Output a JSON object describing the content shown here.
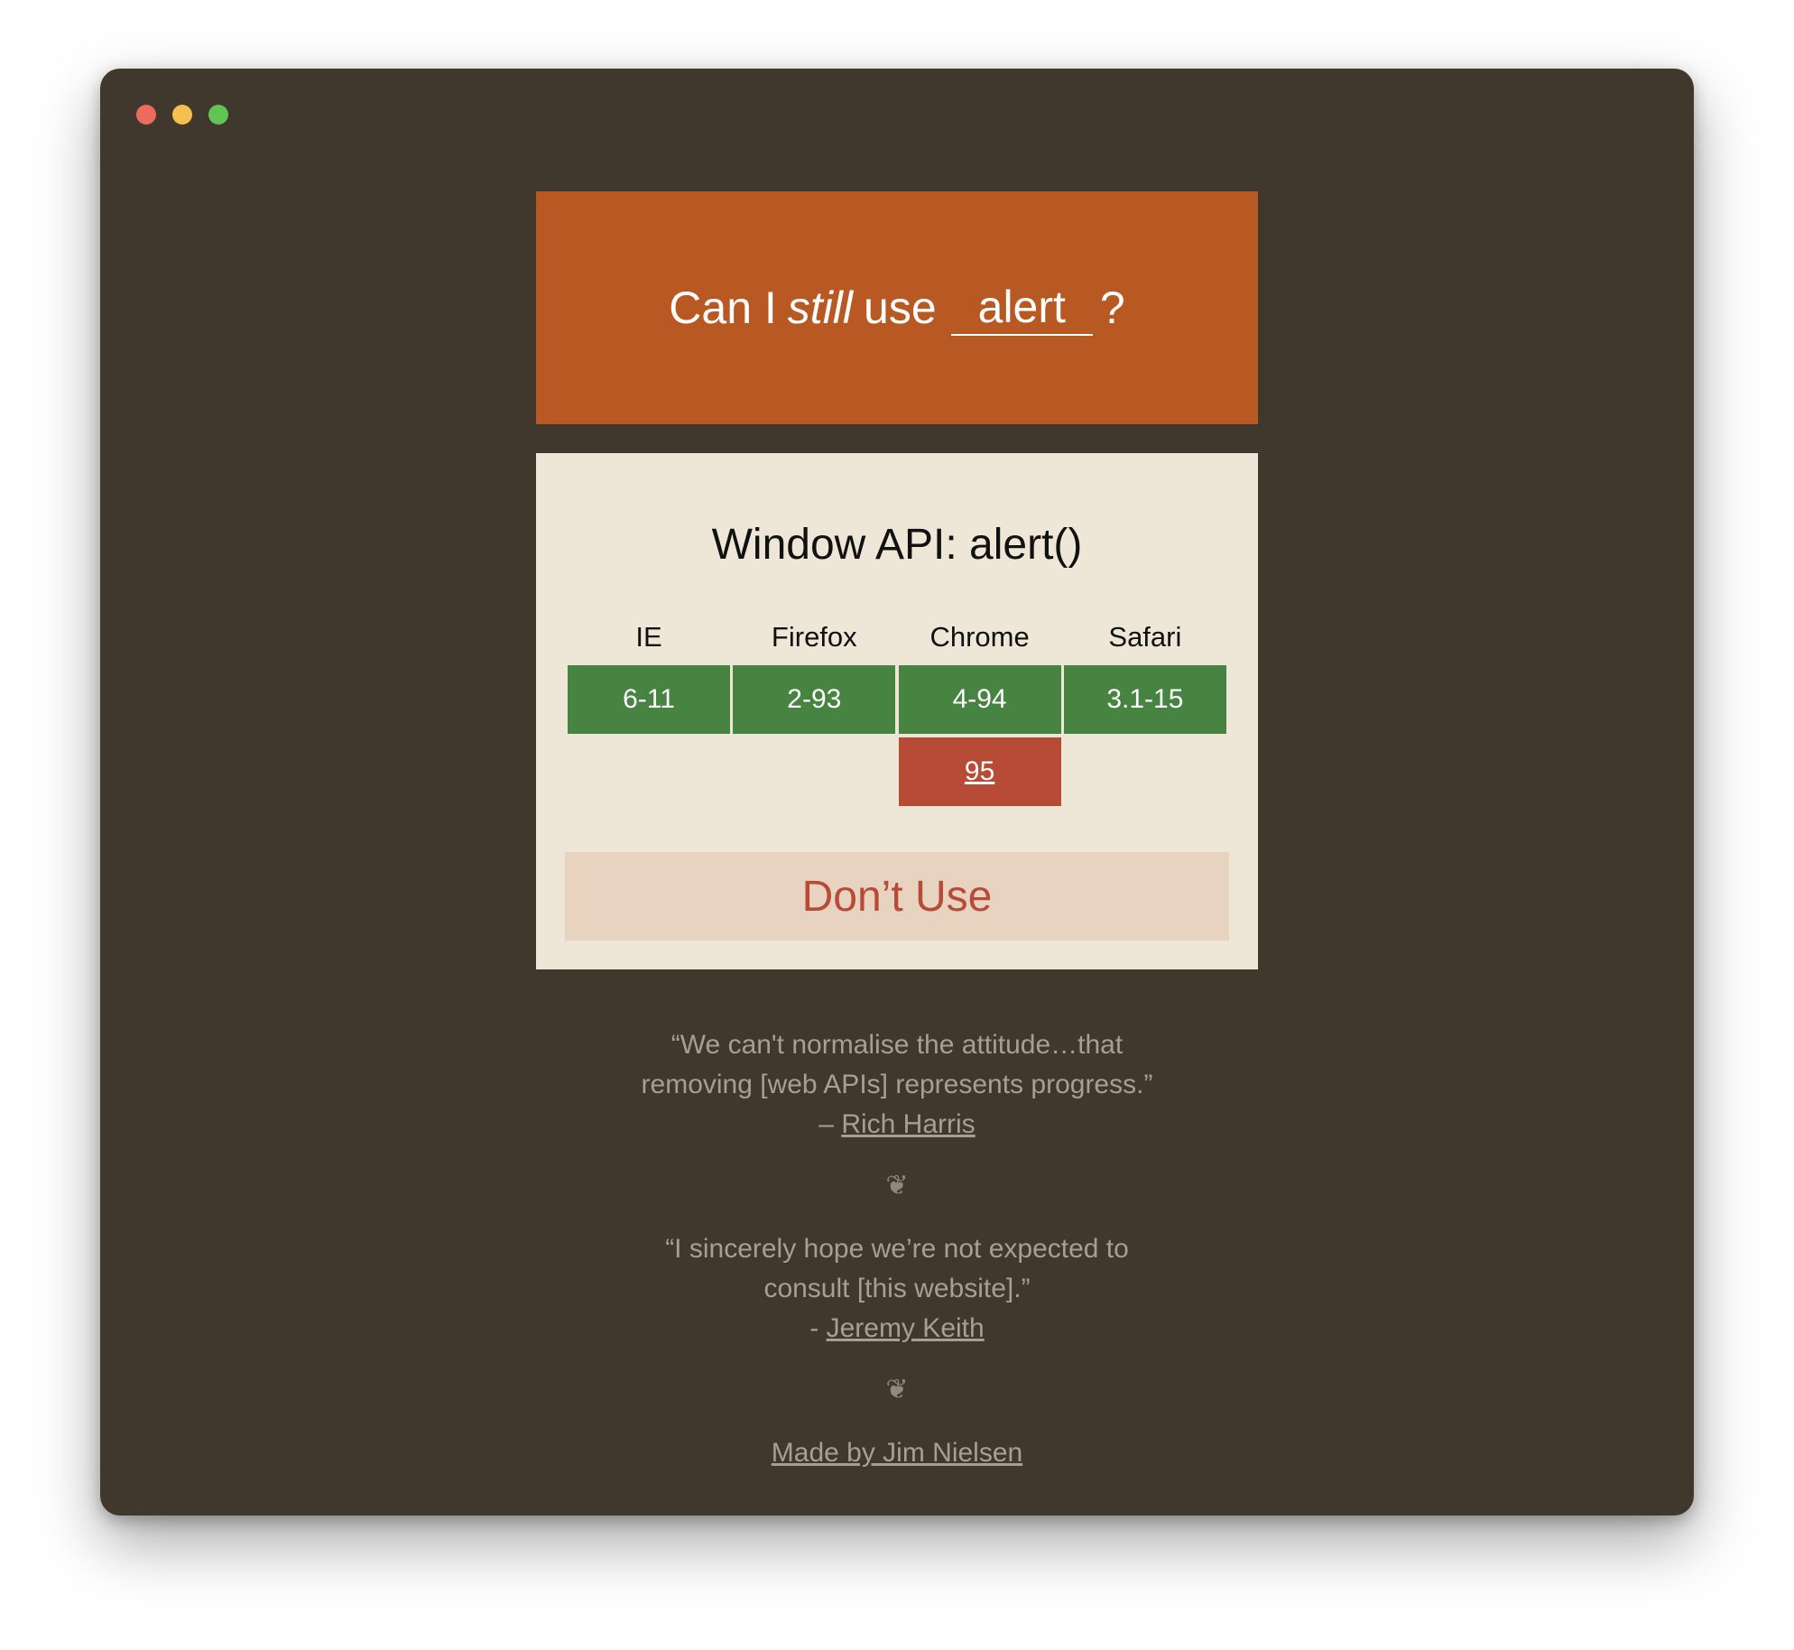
{
  "hero": {
    "prefix": "Can I",
    "emphasis": "still",
    "middle": "use",
    "api_value": "alert",
    "suffix": "?"
  },
  "card": {
    "title": "Window API: alert()",
    "browsers": [
      {
        "name": "IE",
        "supported": "6-11",
        "unsupported": ""
      },
      {
        "name": "Firefox",
        "supported": "2-93",
        "unsupported": ""
      },
      {
        "name": "Chrome",
        "supported": "4-94",
        "unsupported": "95"
      },
      {
        "name": "Safari",
        "supported": "3.1-15",
        "unsupported": ""
      }
    ],
    "verdict": "Don’t Use"
  },
  "quotes": [
    {
      "text_line1": "“We can't normalise the attitude…that",
      "text_line2": "removing [web APIs] represents progress.”",
      "attribution_prefix": "– ",
      "author": "Rich Harris"
    },
    {
      "text_line1": "“I sincerely hope we’re not expected to",
      "text_line2": "consult [this website].”",
      "attribution_prefix": "- ",
      "author": "Jeremy Keith"
    }
  ],
  "fleuron": "❦",
  "footer": {
    "link_text": "Made by Jim Nielsen"
  },
  "colors": {
    "background": "#40382c",
    "hero": "#b85923",
    "card": "#eee6d6",
    "supported": "#478441",
    "unsupported": "#b74b38",
    "verdict_bg": "#e8d2c0"
  }
}
